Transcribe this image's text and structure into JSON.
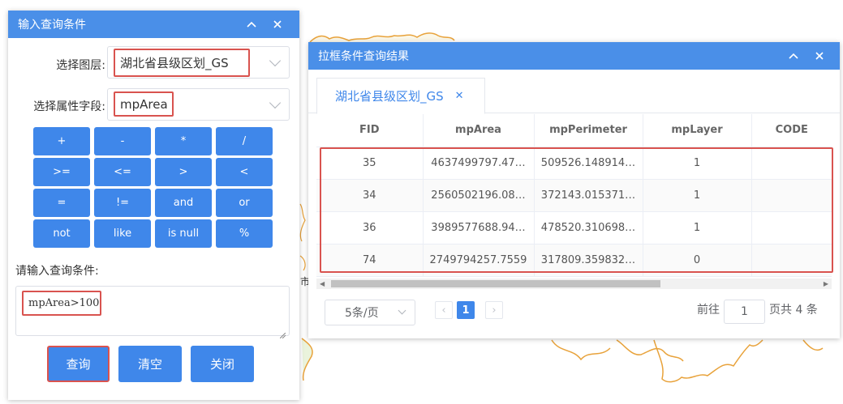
{
  "query_panel": {
    "title": "输入查询条件",
    "layer_label": "选择图层:",
    "layer_value": "湖北省县级区划_GS",
    "field_label": "选择属性字段:",
    "field_value": "mpArea",
    "operators": [
      "+",
      "-",
      "*",
      "/",
      ">=",
      "<=",
      ">",
      "<",
      "=",
      "!=",
      "and",
      "or",
      "not",
      "like",
      "is null",
      "%"
    ],
    "condition_label": "请输入查询条件:",
    "condition_value": "mpArea>100",
    "buttons": {
      "query": "查询",
      "clear": "清空",
      "close": "关闭"
    }
  },
  "result_panel": {
    "title": "拉框条件查询结果",
    "tab_label": "湖北省县级区划_GS",
    "columns": [
      "FID",
      "mpArea",
      "mpPerimeter",
      "mpLayer",
      "CODE"
    ],
    "rows": [
      [
        "35",
        "4637499797.47…",
        "509526.148914…",
        "1",
        ""
      ],
      [
        "34",
        "2560502196.08…",
        "372143.015371…",
        "1",
        ""
      ],
      [
        "36",
        "3989577688.94…",
        "478520.310698…",
        "1",
        ""
      ],
      [
        "74",
        "2749794257.7559",
        "317809.359832…",
        "0",
        ""
      ]
    ],
    "pagination": {
      "page_size": "5条/页",
      "current_page": "1",
      "goto_label": "前往",
      "goto_value": "1",
      "total_text": "页共 4 条"
    }
  },
  "map_labels": [
    "市"
  ],
  "colors": {
    "accent": "#3f87ea",
    "header": "#4a8fe8",
    "highlight": "#d9534f",
    "map_line": "#e8a23a"
  }
}
